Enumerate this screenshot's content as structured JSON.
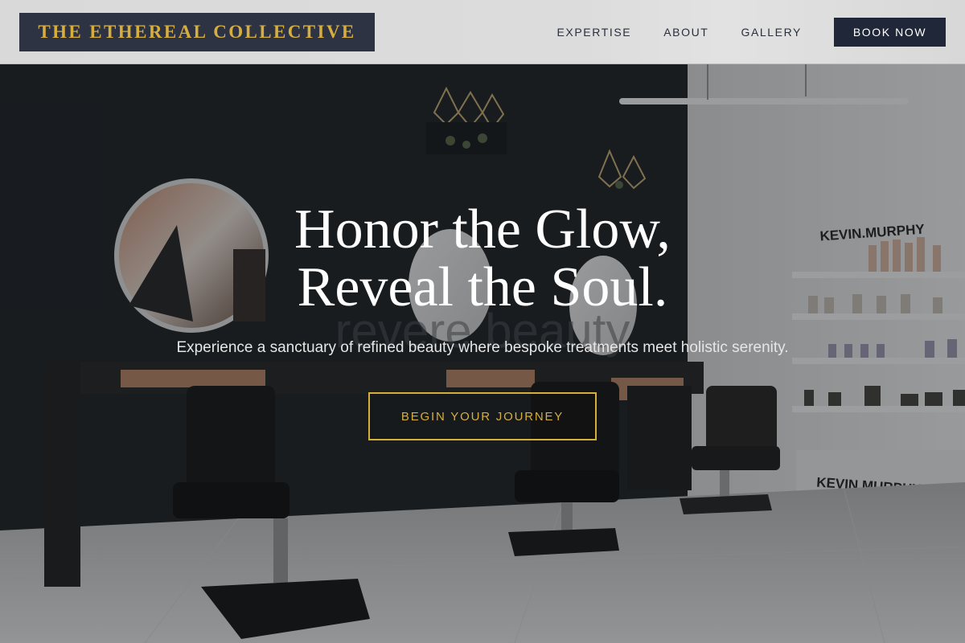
{
  "header": {
    "logo_text": "THE ETHEREAL COLLECTIVE",
    "nav": [
      {
        "label": "EXPERTISE"
      },
      {
        "label": "ABOUT"
      },
      {
        "label": "GALLERY"
      }
    ],
    "book_label": "BOOK NOW"
  },
  "hero": {
    "title_line1": "Honor the Glow,",
    "title_line2": "Reveal the Soul.",
    "subtitle": "Experience a sanctuary of refined beauty where bespoke treatments meet holistic serenity.",
    "cta_label": "BEGIN YOUR JOURNEY",
    "background_signs": {
      "brand_sign_top": "KEVIN.MURPHY",
      "brand_sign_bottom": "KEVIN.MURPHY",
      "wall_logo": "revere beauty"
    }
  },
  "colors": {
    "accent_gold": "#d6ae3e",
    "navy": "#1f2738",
    "logo_bg": "#2e3344"
  }
}
